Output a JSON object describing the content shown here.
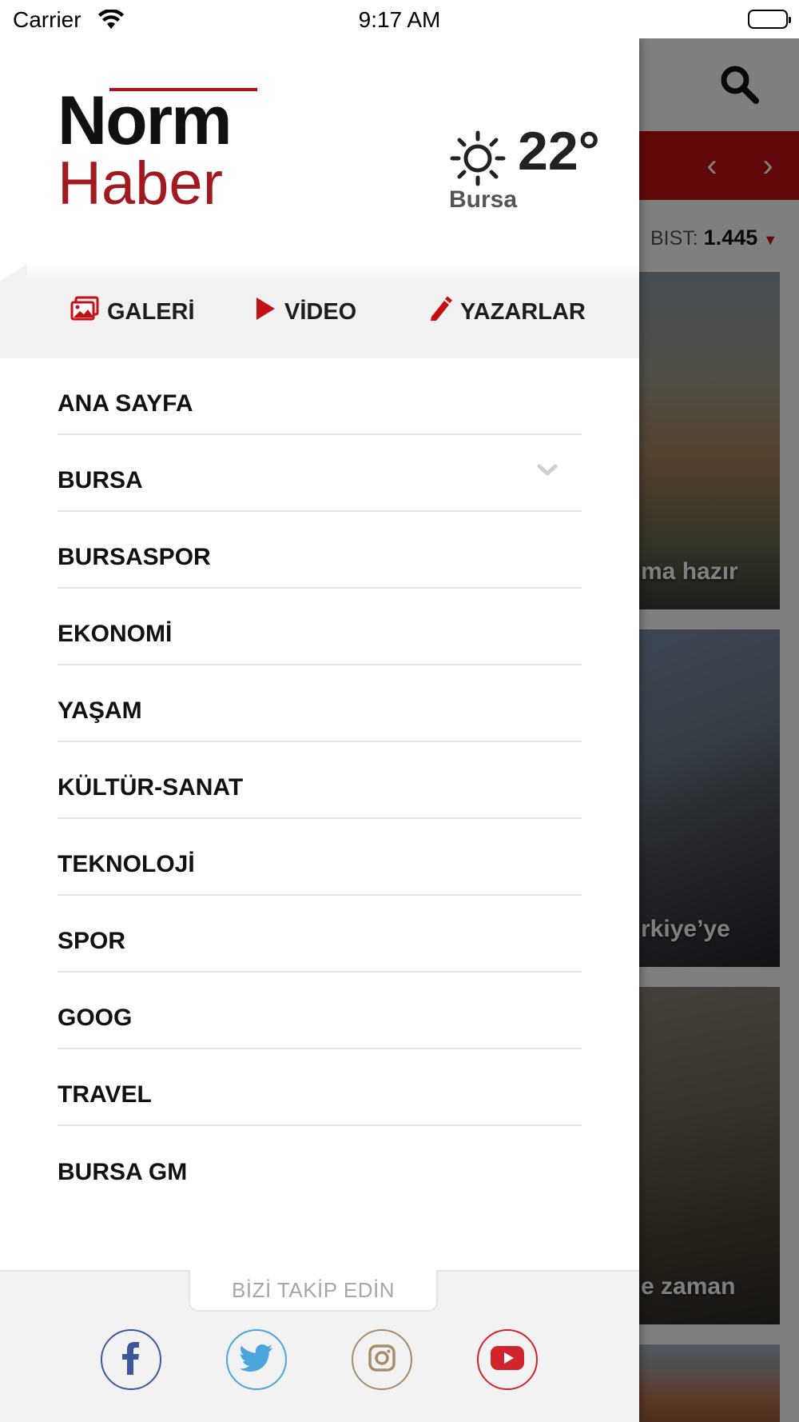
{
  "status_bar": {
    "carrier": "Carrier",
    "time": "9:17 AM"
  },
  "drawer": {
    "logo": {
      "line1": "Norm",
      "line2": "Haber"
    },
    "weather": {
      "temperature": "22°",
      "city": "Bursa",
      "icon": "sun-icon"
    },
    "quick_links": [
      {
        "label": "GALERİ",
        "icon": "gallery-icon"
      },
      {
        "label": "VİDEO",
        "icon": "play-icon"
      },
      {
        "label": "YAZARLAR",
        "icon": "pencil-icon"
      }
    ],
    "menu": [
      {
        "label": "ANA SAYFA"
      },
      {
        "label": "BURSA",
        "expandable": true
      },
      {
        "label": "BURSASPOR"
      },
      {
        "label": "EKONOMİ"
      },
      {
        "label": "YAŞAM"
      },
      {
        "label": "KÜLTÜR-SANAT"
      },
      {
        "label": "TEKNOLOJİ"
      },
      {
        "label": "SPOR"
      },
      {
        "label": "GOOG"
      },
      {
        "label": "TRAVEL"
      },
      {
        "label": "BURSA GM"
      }
    ],
    "footer": {
      "follow_label": "BİZİ TAKİP EDİN",
      "social": [
        {
          "name": "facebook",
          "color": "#3b5998"
        },
        {
          "name": "twitter",
          "color": "#4aa6dc"
        },
        {
          "name": "instagram",
          "color": "#a78d6d"
        },
        {
          "name": "youtube",
          "color": "#d0252d"
        }
      ]
    }
  },
  "background_app": {
    "bist_label": "BIST:",
    "bist_value": "1.445",
    "card_captions": [
      "ma hazır",
      "rkiye’ye",
      "e zaman"
    ]
  },
  "colors": {
    "accent_red": "#c40f14",
    "logo_red": "#a11a1f"
  }
}
